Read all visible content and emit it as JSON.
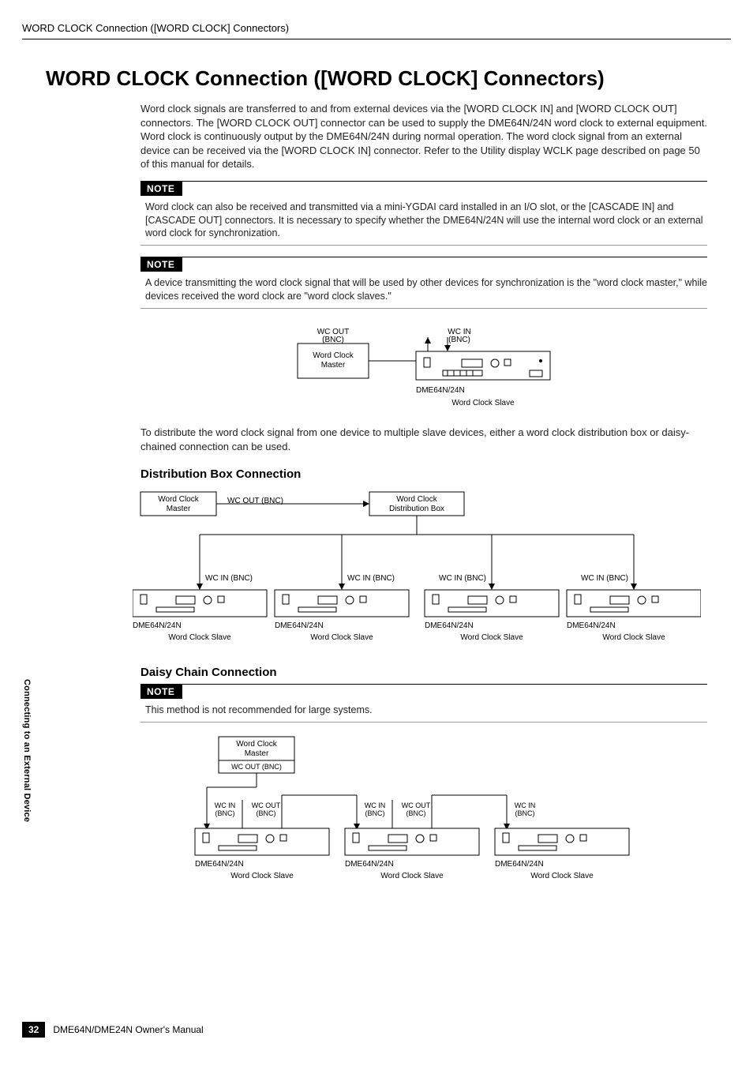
{
  "header": {
    "running_title": "WORD CLOCK Connection ([WORD CLOCK] Connectors)"
  },
  "main": {
    "h1": "WORD CLOCK Connection ([WORD CLOCK] Connectors)",
    "intro": "Word clock signals are transferred to and from external devices via the [WORD CLOCK IN] and [WORD CLOCK OUT] connectors. The [WORD CLOCK OUT] connector can be used to supply the DME64N/24N word clock to external equipment. Word clock is continuously output by the DME64N/24N during normal operation. The word clock signal from an external device can be received via the [WORD CLOCK IN] connector. Refer to the Utility display WCLK page described on page 50 of this manual for details.",
    "note_label": "NOTE",
    "note1": "Word clock can also be received and transmitted via a mini-YGDAI card installed in an I/O slot, or the [CASCADE IN] and [CASCADE OUT] connectors. It is necessary to specify whether the DME64N/24N will use the internal word clock or an external word clock for synchronization.",
    "note2": "A device transmitting the word clock signal that will be used by other devices for synchronization is the \"word clock master,\" while devices received the word clock are \"word clock slaves.\"",
    "distribute_text": "To distribute the word clock signal from one device to multiple slave devices, either a word clock distribution box or daisy-chained connection can be used.",
    "h2_box": "Distribution Box Connection",
    "h2_daisy": "Daisy Chain Connection",
    "note3": "This method is not recommended for large systems.",
    "labels": {
      "wcout_bnc": "WC OUT (BNC)",
      "wcin_bnc": "WC IN (BNC)",
      "wcout": "WC OUT",
      "wcin": "WC IN",
      "bnc": "(BNC)",
      "wc_out_bnc_inline": "WC OUT\n(BNC)",
      "wc_in_bnc_inline": "WC IN\n(BNC)",
      "master": "Word Clock\nMaster",
      "master_line1": "Word Clock",
      "master_line2": "Master",
      "distbox": "Word Clock\nDistribution Box",
      "distbox_line1": "Word Clock",
      "distbox_line2": "Distribution Box",
      "dme": "DME64N/24N",
      "slave": "Word Clock Slave"
    }
  },
  "sidebar": {
    "chapter": "Connecting to an External Device"
  },
  "footer": {
    "page": "32",
    "manual": "DME64N/DME24N Owner's Manual"
  }
}
